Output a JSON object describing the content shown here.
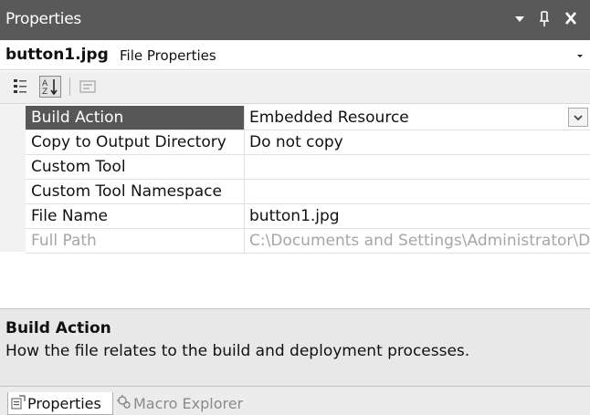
{
  "window": {
    "title": "Properties",
    "controls": {
      "dropdown_icon": "chevron-down-icon",
      "pin_icon": "pin-icon",
      "close_icon": "close-icon"
    }
  },
  "object_selector": {
    "name": "button1.jpg",
    "type": "File Properties"
  },
  "toolbar": {
    "buttons": [
      {
        "name": "categorized-icon",
        "pressed": false
      },
      {
        "name": "alphabetical-icon",
        "pressed": true
      },
      {
        "name": "property-pages-icon",
        "pressed": false
      }
    ]
  },
  "properties": [
    {
      "name": "Build Action",
      "value": "Embedded Resource",
      "selected": true,
      "disabled": false
    },
    {
      "name": "Copy to Output Directory",
      "value": "Do not copy",
      "selected": false,
      "disabled": false
    },
    {
      "name": "Custom Tool",
      "value": "",
      "selected": false,
      "disabled": false
    },
    {
      "name": "Custom Tool Namespace",
      "value": "",
      "selected": false,
      "disabled": false
    },
    {
      "name": "File Name",
      "value": "button1.jpg",
      "selected": false,
      "disabled": false
    },
    {
      "name": "Full Path",
      "value": "C:\\Documents and Settings\\Administrator\\De",
      "selected": false,
      "disabled": true
    }
  ],
  "description": {
    "title": "Build Action",
    "text": "How the file relates to the build and deployment processes."
  },
  "tabs": [
    {
      "label": "Properties",
      "active": true,
      "icon": "properties-icon"
    },
    {
      "label": "Macro Explorer",
      "active": false,
      "icon": "macro-explorer-icon"
    }
  ],
  "colors": {
    "title_bar": "#595959",
    "selected_row": "#575757",
    "description_pane": "#e8e8e8"
  }
}
